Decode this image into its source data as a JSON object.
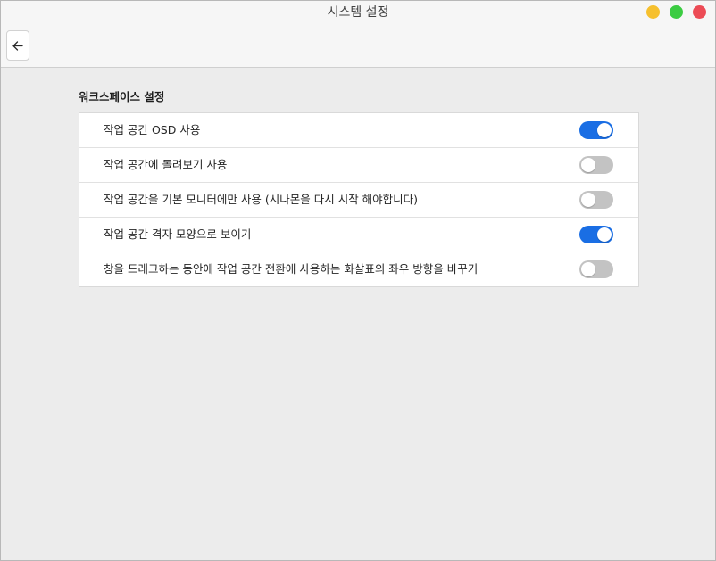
{
  "window": {
    "title": "시스템 설정"
  },
  "section": {
    "title": "워크스페이스 설정"
  },
  "settings": [
    {
      "label": "작업 공간 OSD 사용",
      "enabled": true
    },
    {
      "label": "작업 공간에 돌려보기 사용",
      "enabled": false
    },
    {
      "label": "작업 공간을 기본 모니터에만 사용 (시나몬을 다시 시작 해야합니다)",
      "enabled": false
    },
    {
      "label": "작업 공간 격자 모양으로 보이기",
      "enabled": true
    },
    {
      "label": "창을 드래그하는 동안에 작업 공간 전환에 사용하는 화살표의 좌우 방향을 바꾸기",
      "enabled": false
    }
  ],
  "colors": {
    "toggle_on": "#1a6ee4",
    "toggle_off": "#c3c3c3",
    "minimize": "#f6c02e",
    "maximize": "#3bcc42",
    "close": "#ec4b55"
  },
  "icons": {
    "back": "arrow-left-icon"
  }
}
